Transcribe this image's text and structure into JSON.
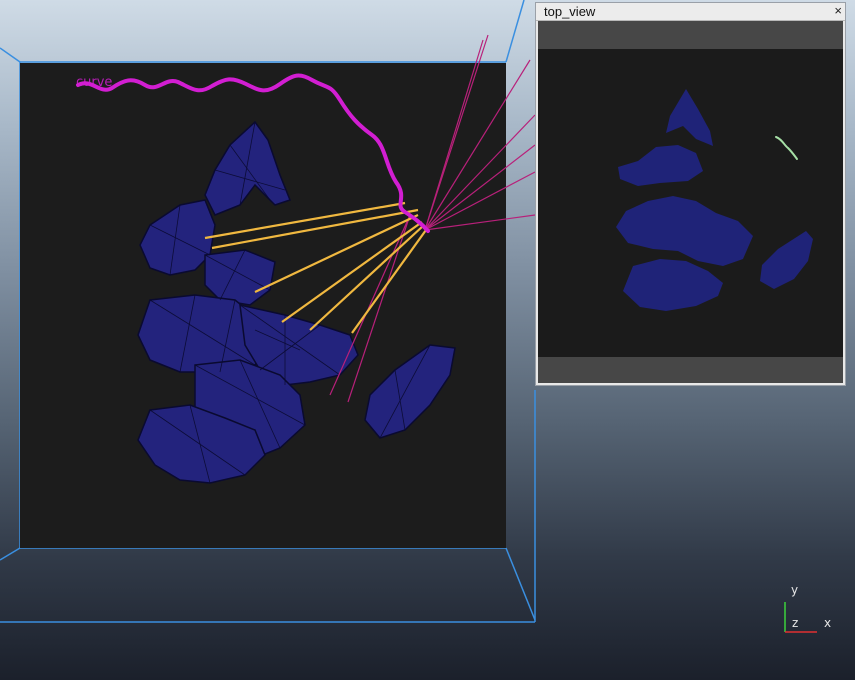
{
  "viewport": {
    "curve_label": "curve",
    "colors": {
      "background_panel": "#1c1c1c",
      "mesh_fill": "#23237d",
      "mesh_edge": "#0a0a30",
      "curve": "#d21ed2",
      "rays_yellow": "#f0b840",
      "rays_magenta": "#b8207a",
      "bounding_box": "#3a8fe0"
    }
  },
  "top_view": {
    "title": "top_view",
    "close_icon": "×"
  },
  "axis_gizmo": {
    "y_label": "y",
    "z_label": "z",
    "x_label": "x"
  }
}
